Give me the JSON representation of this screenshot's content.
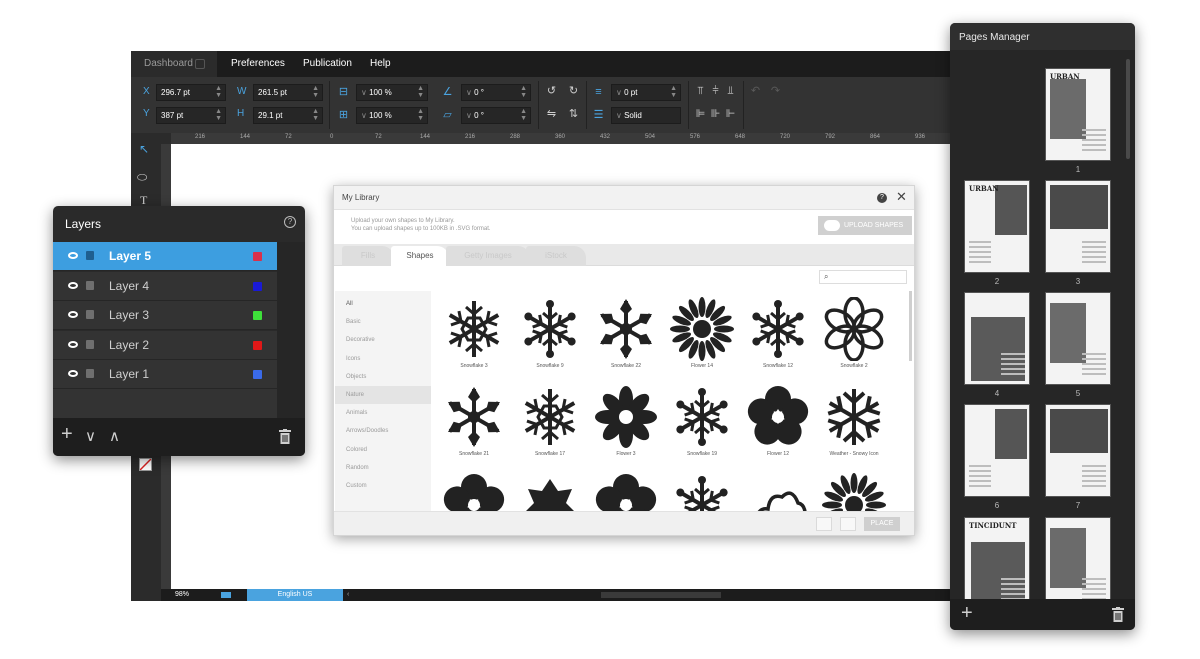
{
  "menubar": {
    "dashboard": "Dashboard",
    "preferences": "Preferences",
    "publication": "Publication",
    "help": "Help"
  },
  "toolbar": {
    "x_label": "X",
    "x_value": "296.7 pt",
    "y_label": "Y",
    "y_value": "387 pt",
    "w_label": "W",
    "w_value": "261.5 pt",
    "h_label": "H",
    "h_value": "29.1 pt",
    "scale_w": "100 %",
    "scale_h": "100 %",
    "angle": "0 °",
    "skew": "0 °",
    "stroke_width": "0 pt",
    "stroke_style": "Solid"
  },
  "ruler_marks": [
    "216",
    "144",
    "72",
    "0",
    "72",
    "144",
    "216",
    "288",
    "360",
    "432",
    "504",
    "576",
    "648",
    "720",
    "792",
    "864",
    "936"
  ],
  "status": {
    "zoom": "98%",
    "language": "English US"
  },
  "layers": {
    "title": "Layers",
    "items": [
      {
        "name": "Layer 5",
        "color": "#d9304a",
        "active": true
      },
      {
        "name": "Layer 4",
        "color": "#1a1ad6",
        "active": false
      },
      {
        "name": "Layer 3",
        "color": "#3ee03a",
        "active": false
      },
      {
        "name": "Layer 2",
        "color": "#e01818",
        "active": false
      },
      {
        "name": "Layer 1",
        "color": "#3a6ae8",
        "active": false
      }
    ]
  },
  "library": {
    "title": "My Library",
    "description_line1": "Upload your own shapes to My Library.",
    "description_line2": "You can upload shapes up to 100KB in .SVG format.",
    "upload_button": "UPLOAD SHAPES",
    "tabs": [
      "Fills",
      "Shapes",
      "Getty Images",
      "iStock"
    ],
    "active_tab": "Shapes",
    "categories": [
      "All",
      "Basic",
      "Decorative",
      "Icons",
      "Objects",
      "Nature",
      "Animals",
      "Arrows/Doodles",
      "Colored",
      "Random",
      "Custom"
    ],
    "active_category": "Nature",
    "shapes": [
      "Snowflake 3",
      "Snowflake 9",
      "Snowflake 22",
      "Flower 14",
      "Snowflake 12",
      "Snowflake 2",
      "Snowflake 21",
      "Snowflake 17",
      "Flower 3",
      "Snowflake 19",
      "Flower 12",
      "Weather - Snowy Icon",
      "",
      "",
      "",
      "",
      "",
      ""
    ],
    "place_button": "PLACE"
  },
  "pages": {
    "title": "Pages Manager",
    "thumbs": [
      {
        "num": "1",
        "cover": "URBAN"
      },
      {
        "num": "2",
        "cover": "URBAN"
      },
      {
        "num": "3",
        "cover": ""
      },
      {
        "num": "4",
        "cover": ""
      },
      {
        "num": "5",
        "cover": ""
      },
      {
        "num": "6",
        "cover": ""
      },
      {
        "num": "7",
        "cover": ""
      },
      {
        "num": "",
        "cover": "TINCIDUNT"
      },
      {
        "num": "",
        "cover": ""
      }
    ]
  }
}
